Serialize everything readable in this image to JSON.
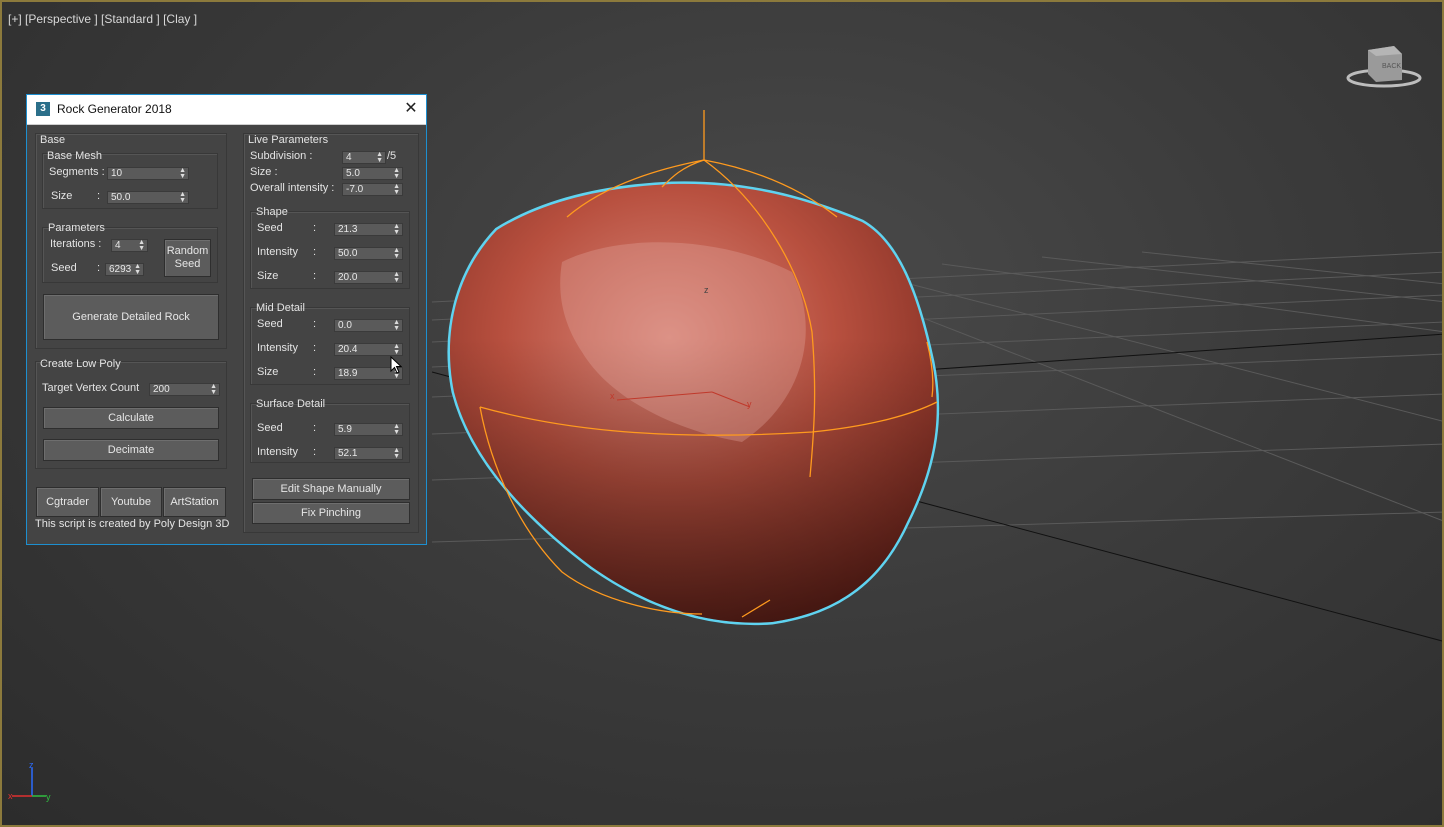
{
  "viewport": {
    "label": "[+] [Perspective ] [Standard ] [Clay ]",
    "viewcube_face": "BACK",
    "axis_z": "z",
    "axis_x": "x",
    "axis_y": "y",
    "gizmo_z": "z",
    "gizmo_x": "x",
    "gizmo_y": "y"
  },
  "dialog": {
    "icon": "3",
    "title": "Rock Generator 2018",
    "close_glyph": "✕",
    "base": {
      "title": "Base",
      "base_mesh": {
        "title": "Base Mesh",
        "segments_label": "Segments :",
        "segments_value": "10",
        "size_label": "Size",
        "size_colon": ":",
        "size_value": "50.0"
      },
      "parameters": {
        "title": "Parameters",
        "iterations_label": "Iterations :",
        "iterations_value": "4",
        "seed_label": "Seed",
        "seed_colon": ":",
        "seed_value": "6293",
        "random_seed_line1": "Random",
        "random_seed_line2": "Seed"
      },
      "generate_label": "Generate Detailed Rock"
    },
    "low_poly": {
      "title": "Create Low Poly",
      "target_label": "Target Vertex Count",
      "target_value": "200",
      "calculate_label": "Calculate",
      "decimate_label": "Decimate"
    },
    "links": [
      "Cgtrader",
      "Youtube",
      "ArtStation"
    ],
    "footer": "This script is created by Poly Design 3D",
    "live": {
      "title": "Live Parameters",
      "subdivision_label": "Subdivision :",
      "subdivision_value": "4",
      "subdivision_max": "/5",
      "size_label": "Size :",
      "size_value": "5.0",
      "overall_label": "Overall intensity :",
      "overall_value": "-7.0",
      "shape": {
        "title": "Shape",
        "seed_label": "Seed",
        "seed_value": "21.3",
        "intensity_label": "Intensity",
        "intensity_value": "50.0",
        "size_label": "Size",
        "size_value": "20.0"
      },
      "mid": {
        "title": "Mid Detail",
        "seed_label": "Seed",
        "seed_value": "0.0",
        "intensity_label": "Intensity",
        "intensity_value": "20.4",
        "size_label": "Size",
        "size_value": "18.9"
      },
      "surface": {
        "title": "Surface Detail",
        "seed_label": "Seed",
        "seed_value": "5.9",
        "intensity_label": "Intensity",
        "intensity_value": "52.1"
      },
      "colon": ":",
      "edit_shape_label": "Edit Shape Manually",
      "fix_pinching_label": "Fix Pinching"
    }
  },
  "colors": {
    "viewport_bg": "#3b3b3b",
    "viewport_border": "#8c7a3c",
    "rock": "#b84a3a",
    "selection_outline": "#5fd3f0",
    "cage": "#ff9a1e",
    "dialog_bg": "#444444",
    "dialog_border": "#1d8fd0"
  }
}
